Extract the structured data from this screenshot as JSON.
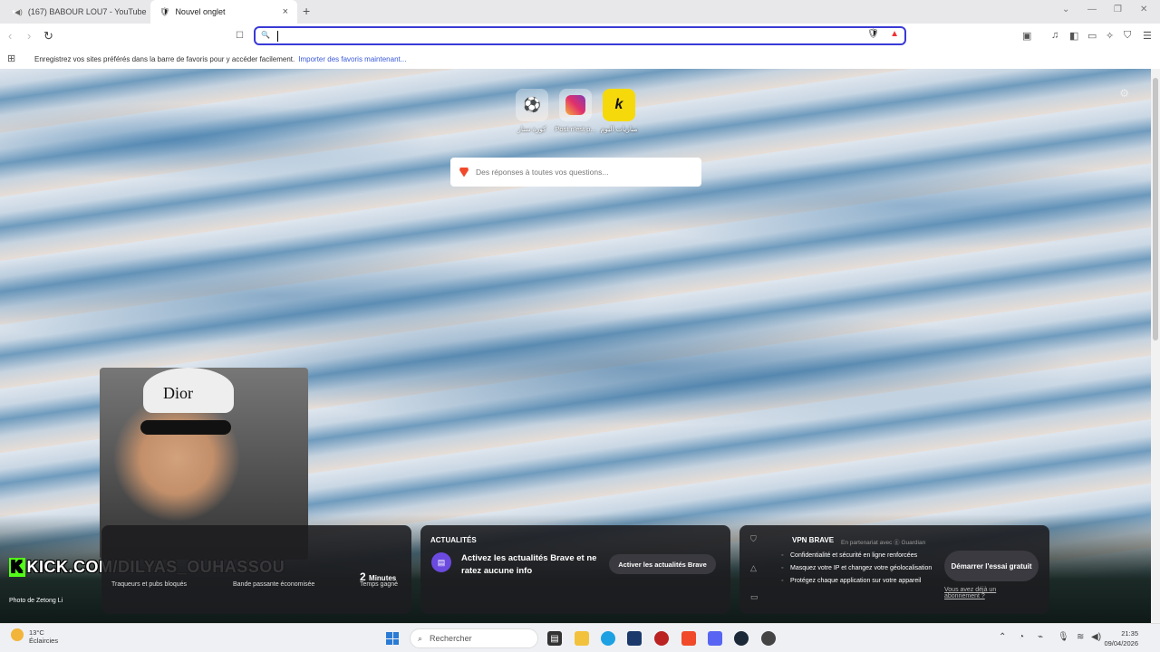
{
  "tabs": [
    {
      "label": "(167) BABOUR LOU7 - YouTube"
    },
    {
      "label": "Nouvel onglet",
      "close": "×"
    }
  ],
  "new_tab": "+",
  "window_controls": {
    "chevron": "⌄",
    "minimize": "—",
    "restore": "❐",
    "close": "✕"
  },
  "toolbar": {
    "back": "‹",
    "forward": "›",
    "reload": "↻",
    "bookmark": "☐"
  },
  "bookmarks_bar": {
    "message": "Enregistrez vos sites préférés dans la barre de favoris pour y accéder facilement.",
    "link": "Importer des favoris maintenant..."
  },
  "top_sites": [
    {
      "label": "كورة ستار",
      "glyph": "⚽"
    },
    {
      "label": "Post n'est p...",
      "glyph": ""
    },
    {
      "label": "مباريات اليوم",
      "glyph": "k"
    }
  ],
  "search": {
    "placeholder": "Des réponses à toutes vos questions..."
  },
  "stream": {
    "cap_text": "Dior",
    "overlay_k": "K",
    "overlay": "KICK.COM/DILYAS_OUHASSOU",
    "credit": "Photo de Zetong Li"
  },
  "stats": {
    "trackers_label": "Traqueurs et pubs bloqués",
    "bandwidth_label": "Bande passante économisée",
    "time_value": "2",
    "time_unit": "Minutes",
    "time_label": "Temps gagné"
  },
  "news": {
    "header": "ACTUALITÉS",
    "text": "Activez les actualités Brave et ne ratez aucune info",
    "button": "Activer les actualités Brave",
    "icon": "▤"
  },
  "vpn": {
    "title": "VPN BRAVE",
    "partner": "En partenariat avec ⓖ Guardian",
    "items": [
      "Confidentialité et sécurité en ligne renforcées",
      "Masquez votre IP et changez votre géolocalisation",
      "Protégez chaque application sur votre appareil"
    ],
    "button": "Démarrer l'essai gratuit",
    "link": "Vous avez déjà un abonnement ?"
  },
  "taskbar": {
    "temp": "13°C",
    "condition": "Éclaircies",
    "search": "Rechercher",
    "time": "21:35",
    "date": "09/04/2026"
  }
}
